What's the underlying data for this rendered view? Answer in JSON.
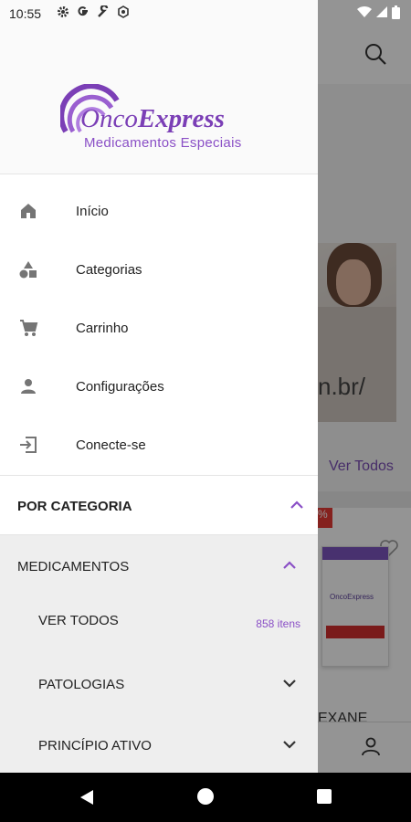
{
  "status_bar": {
    "time": "10:55"
  },
  "background": {
    "banner_url_fragment": "n.br/",
    "see_all": "Ver Todos",
    "discount_badge": "%",
    "product_box_logo": "OncoExpress",
    "product_name_fragment": "EXANE"
  },
  "drawer": {
    "logo": {
      "word_light": "Onco",
      "word_bold": "Express",
      "subtitle": "Medicamentos Especiais"
    },
    "menu": [
      {
        "label": "Início",
        "icon": "home-icon"
      },
      {
        "label": "Categorias",
        "icon": "categories-icon"
      },
      {
        "label": "Carrinho",
        "icon": "cart-icon"
      },
      {
        "label": "Configurações",
        "icon": "person-icon"
      },
      {
        "label": "Conecte-se",
        "icon": "login-icon"
      }
    ],
    "by_category": {
      "title": "POR CATEGORIA",
      "group": {
        "title": "MEDICAMENTOS",
        "items": [
          {
            "label": "VER TODOS",
            "count": "858 itens"
          },
          {
            "label": "PATOLOGIAS"
          },
          {
            "label": "PRINCÍPIO ATIVO"
          }
        ]
      }
    }
  },
  "colors": {
    "accent": "#8a4fc6",
    "logo": "#7b3fb6",
    "scrim": "rgba(0,0,0,0.42)"
  }
}
